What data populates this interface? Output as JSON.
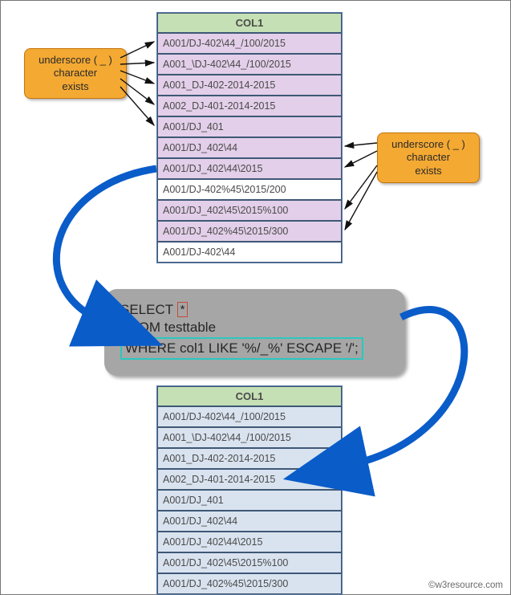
{
  "callouts": {
    "left": {
      "line1": "underscore ( _ )",
      "line2": "character",
      "line3": "exists"
    },
    "right": {
      "line1": "underscore ( _ )",
      "line2": "character",
      "line3": "exists"
    }
  },
  "source_table": {
    "header": "COL1",
    "rows": [
      {
        "value": "A001/DJ-402\\44_/100/2015",
        "has_underscore": true
      },
      {
        "value": "A001_\\DJ-402\\44_/100/2015",
        "has_underscore": true
      },
      {
        "value": "A001_DJ-402-2014-2015",
        "has_underscore": true
      },
      {
        "value": "A002_DJ-401-2014-2015",
        "has_underscore": true
      },
      {
        "value": "A001/DJ_401",
        "has_underscore": true
      },
      {
        "value": "A001/DJ_402\\44",
        "has_underscore": true
      },
      {
        "value": "A001/DJ_402\\44\\2015",
        "has_underscore": true
      },
      {
        "value": "A001/DJ-402%45\\2015/200",
        "has_underscore": false
      },
      {
        "value": "A001/DJ_402\\45\\2015%100",
        "has_underscore": true
      },
      {
        "value": "A001/DJ_402%45\\2015/300",
        "has_underscore": true
      },
      {
        "value": "A001/DJ-402\\44",
        "has_underscore": false
      }
    ]
  },
  "sql": {
    "select_kw": "SELECT",
    "star": "*",
    "from": "FROM testtable",
    "where": "WHERE col1   LIKE '%/_%' ESCAPE '/';"
  },
  "result_table": {
    "header": "COL1",
    "rows": [
      "A001/DJ-402\\44_/100/2015",
      "A001_\\DJ-402\\44_/100/2015",
      "A001_DJ-402-2014-2015",
      "A002_DJ-401-2014-2015",
      "A001/DJ_401",
      "A001/DJ_402\\44",
      "A001/DJ_402\\44\\2015",
      "A001/DJ_402\\45\\2015%100",
      "A001/DJ_402%45\\2015/300"
    ]
  },
  "credit": "©w3resource.com"
}
